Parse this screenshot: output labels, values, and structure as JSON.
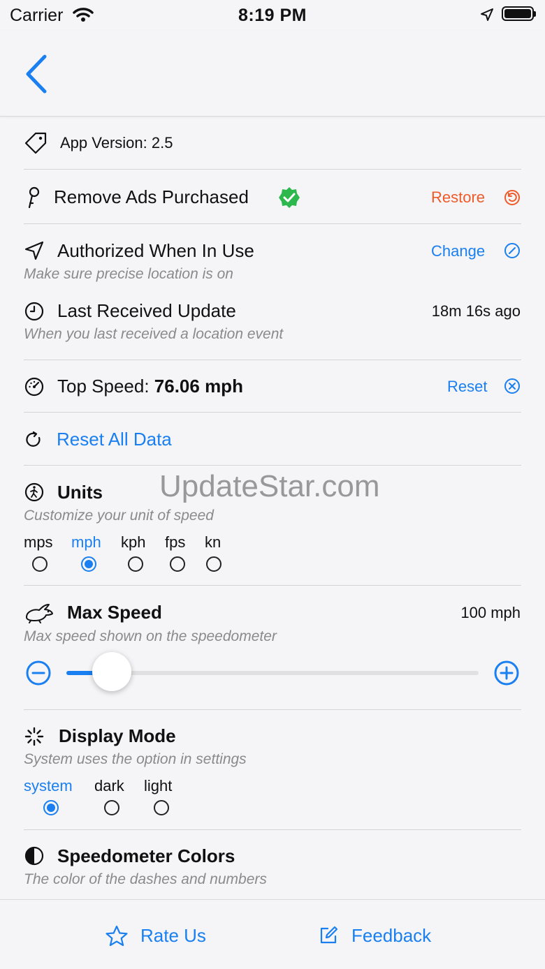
{
  "status_bar": {
    "carrier": "Carrier",
    "time": "8:19 PM"
  },
  "rows": {
    "app_version": "App Version: 2.5",
    "remove_ads": {
      "label": "Remove Ads Purchased",
      "action": "Restore"
    },
    "authorization": {
      "label": "Authorized When In Use",
      "subtitle": "Make sure precise location is on",
      "action": "Change"
    },
    "last_update": {
      "label": "Last Received Update",
      "subtitle": "When you last received a location event",
      "value": "18m 16s ago"
    },
    "top_speed": {
      "label": "Top Speed: ",
      "value": "76.06 mph",
      "action": "Reset"
    },
    "reset_all": "Reset All Data",
    "units": {
      "label": "Units",
      "subtitle": "Customize your unit of speed",
      "options": [
        "mps",
        "mph",
        "kph",
        "fps",
        "kn"
      ],
      "selected": "mph"
    },
    "max_speed": {
      "label": "Max Speed",
      "subtitle": "Max speed shown on the speedometer",
      "value": "100 mph",
      "slider_fraction": 0.11
    },
    "display_mode": {
      "label": "Display Mode",
      "subtitle": "System uses the option in settings",
      "options": [
        "system",
        "dark",
        "light"
      ],
      "selected": "system"
    },
    "speedometer_colors": {
      "label": "Speedometer Colors",
      "subtitle": "The color of the dashes and numbers"
    }
  },
  "watermark": "UpdateStar.com",
  "tab_bar": {
    "rate": "Rate Us",
    "feedback": "Feedback"
  },
  "colors": {
    "accent": "#1a7ff0",
    "restore": "#f05a28",
    "verified": "#2db84d"
  }
}
